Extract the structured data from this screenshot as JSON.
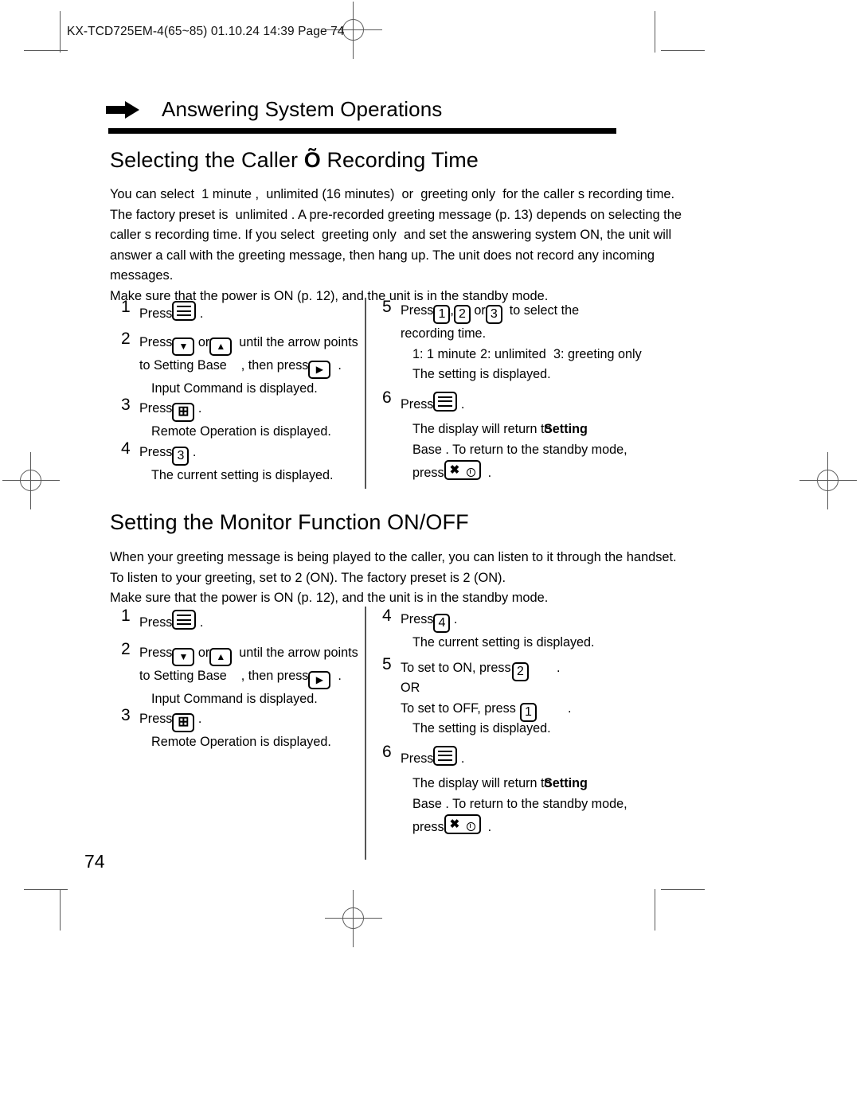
{
  "print_imprint": "KX-TCD725EM-4(65~85)   01.10.24 14:39   Page  74",
  "page_number": "74",
  "section_kicker": "Answering System Operations",
  "sections": [
    {
      "heading_pre": "Selecting the Caller ",
      "heading_glyph": "Õ",
      "heading_post": " Recording Time",
      "body": "You can select  1 minute ,  unlimited (16 minutes)  or  greeting only  for the caller s recording time.\nThe factory preset is  unlimited . A pre-recorded greeting message (p. 13) depends on selecting the\ncaller s recording time. If you select  greeting only  and set the answering system ON, the unit will\nanswer a call with the greeting message, then hang up. The unit does not record any incoming\nmessages.\nMake sure that the power is ON (p. 12), and the unit is in the standby mode.",
      "steps_left": [
        {
          "num": "1",
          "press_label": "Press",
          "key": "menu-key",
          "period": "."
        },
        {
          "num": "2",
          "press_label": "Press",
          "key": "down-arrow-key",
          "or_label": "or",
          "key2": "up-arrow-key",
          "tail": "until the arrow points",
          "line2_pre": "to  Setting Base",
          "line2_mid": ", then press",
          "key3": "right-arrow-key",
          "line2_post": ".",
          "sub": "Input Command     is displayed."
        },
        {
          "num": "3",
          "press_label": "Press",
          "key": "hash-key",
          "period": ".",
          "sub": "Remote Operation        is displayed."
        },
        {
          "num": "4",
          "press_label": "Press",
          "key": "3",
          "period": ".",
          "sub": "The current setting is displayed."
        }
      ],
      "steps_right": [
        {
          "num": "5",
          "press_label": "Press",
          "key": "1",
          "sep1": ",",
          "key2": "2",
          "or_label": "or",
          "key3": "3",
          "tail": "to select the",
          "line2": "recording time.",
          "sub_overlap_a": "1: 1 minute",
          "sub_overlap_b": "2: unlimited",
          "sub_overlap_c": "3: greeting only",
          "sub2": "The setting is displayed."
        },
        {
          "num": "6",
          "press_label": "Press",
          "key": "menu-key",
          "period": ".",
          "sub_a": "The display will return to",
          "sub_b": "Setting",
          "sub_c": "Base . To return to the standby mode,",
          "sub_d_pre": "press",
          "key2": "off-key",
          "sub_d_post": "."
        }
      ]
    },
    {
      "heading_pre": "Setting the Monitor Function ON/OFF",
      "heading_glyph": "",
      "heading_post": "",
      "body": "When your greeting message is being played to the caller, you can listen to it through the handset.\nTo listen to your greeting, set to 2 (ON). The factory preset is 2 (ON).\nMake sure that the power is ON (p. 12), and the unit is in the standby mode.",
      "steps_left": [
        {
          "num": "1",
          "press_label": "Press",
          "key": "menu-key",
          "period": "."
        },
        {
          "num": "2",
          "press_label": "Press",
          "key": "down-arrow-key",
          "or_label": "or",
          "key2": "up-arrow-key",
          "tail": "until the arrow points",
          "line2_pre": "to  Setting Base",
          "line2_mid": ", then press",
          "key3": "right-arrow-key",
          "line2_post": ".",
          "sub": "Input Command     is displayed."
        },
        {
          "num": "3",
          "press_label": "Press",
          "key": "hash-key",
          "period": ".",
          "sub": "Remote Operation        is displayed."
        }
      ],
      "steps_right": [
        {
          "num": "4",
          "press_label": "Press",
          "key": "4",
          "period": ".",
          "sub": "The current setting is displayed."
        },
        {
          "num": "5",
          "on_line_pre": "To set to ON, press",
          "on_key": "2",
          "on_line_post": ".",
          "or_line": "OR",
          "off_line_pre": "To set to OFF, press",
          "off_key": "1",
          "off_line_post": ".",
          "sub": "The setting is displayed."
        },
        {
          "num": "6",
          "press_label": "Press",
          "key": "menu-key",
          "period": ".",
          "sub_a": "The display will return to",
          "sub_b": "Setting",
          "sub_c": "Base . To return to the standby mode,",
          "sub_d_pre": "press",
          "key2": "off-key",
          "sub_d_post": "."
        }
      ]
    }
  ]
}
